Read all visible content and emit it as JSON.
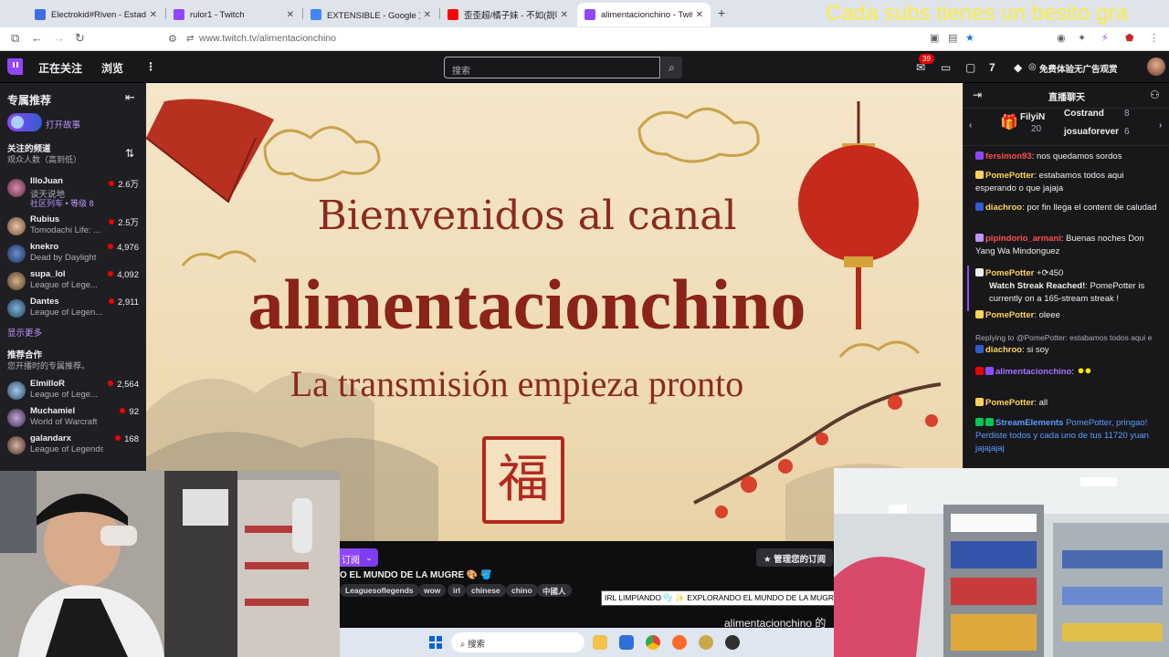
{
  "browser": {
    "tabs": [
      {
        "label": "Electrokid#Riven - Estadístic",
        "active": false
      },
      {
        "label": "rulor1 - Twitch",
        "active": false
      },
      {
        "label": "EXTENSIBLE - Google 文档",
        "active": false
      },
      {
        "label": "歪歪超/橘子妹 - 不如(說唱版)",
        "active": false
      },
      {
        "label": "alimentacionchino - Twitch",
        "active": true
      }
    ],
    "url": "www.twitch.tv/alimentacionchino",
    "overlay_text": "Cada subs tienes un besito gra"
  },
  "twitch_nav": {
    "following": "正在关注",
    "browse": "浏览",
    "more": "⋮",
    "search_placeholder": "搜索",
    "notifications_count": "39",
    "ad_free": "免费体验无广告观赏"
  },
  "sidebar": {
    "title": "专属推荐",
    "story_label": "打开故事",
    "followed_heading": "关注的频道",
    "followed_sort": "观众人数（高到低）",
    "followed": [
      {
        "name": "IlloJuan",
        "game": "谈天说地",
        "viewers": "2.6万",
        "extra": "社区列车 • 等级 8"
      },
      {
        "name": "Rubius",
        "game": "Tomodachi Life: ...",
        "viewers": "2.5万"
      },
      {
        "name": "knekro",
        "game": "Dead by Daylight",
        "viewers": "4,976"
      },
      {
        "name": "supa_lol",
        "game": "League of Lege...",
        "viewers": "4,092"
      },
      {
        "name": "Dantes",
        "game": "League of Legen...",
        "viewers": "2,911"
      }
    ],
    "show_more": "显示更多",
    "recommended_heading": "推荐合作",
    "recommended_sub": "您开播时的专属推荐。",
    "recommended": [
      {
        "name": "ElmilloR",
        "game": "League of Lege...",
        "viewers": "2,564"
      },
      {
        "name": "Muchamiel",
        "game": "World of Warcraft",
        "viewers": "92"
      },
      {
        "name": "galandarx",
        "game": "League of Legends",
        "viewers": "168"
      }
    ]
  },
  "stream": {
    "line1": "Bienvenidos al canal",
    "line2": "alimentacionchino",
    "line3": "La transmisión empieza pronto",
    "seal": "福"
  },
  "info": {
    "follow": "订阅",
    "manage_sub": "管理您的订阅",
    "title_partial": "O EL MUNDO DE LA MUGRE 🎨 🪣",
    "tags": [
      "Leaguesoflegends",
      "wow",
      "irl",
      "chinese",
      "chino",
      "中國人"
    ],
    "tooltip": "IRL LIMPIANDO 🫧 ✨ EXPLORANDO EL MUNDO DE LA MUGRE 🎨",
    "footer_partial": "alimentacionchino 的"
  },
  "chat": {
    "title": "直播聊天",
    "gifters": [
      {
        "name": "FilyiN",
        "count": "20"
      },
      {
        "name": "Costrand",
        "count": "8"
      },
      {
        "name": "josuaforever",
        "count": "6"
      }
    ],
    "messages": [
      {
        "user": "fersimon93",
        "color": "#ff4f4f",
        "text": ": nos quedamos sordos"
      },
      {
        "user": "PomePotter",
        "color": "#ffd257",
        "text": ": estabamos todos aqui esperando o que jajaja"
      },
      {
        "user": "diachroo",
        "color": "#ffd257",
        "text": ": por fin llega el content de caludad"
      },
      {
        "user": "pipindorio_armani",
        "color": "#ff4f4f",
        "text": ": Buenas noches Don Yang Wa Mindonguez"
      },
      {
        "user": "PomePotter",
        "color": "#ffd257",
        "text": " +⟳450"
      },
      {
        "user": "Watch Streak Reached!",
        "color": "#efeff1",
        "text": ": PomePotter is currently on a 165-stream streak !"
      },
      {
        "user": "PomePotter",
        "color": "#ffd257",
        "text": ": oleee"
      },
      {
        "user": "",
        "color": "#adadb8",
        "text": "Replying to @PomePotter: estabamos todos aqui e"
      },
      {
        "user": "diachroo",
        "color": "#ffd257",
        "text": ": si soy"
      },
      {
        "user": "alimentacionchino",
        "color": "#a970ff",
        "text": ":"
      },
      {
        "user": "PomePotter",
        "color": "#ffd257",
        "text": ": all"
      },
      {
        "user": "StreamElements",
        "color": "#5c9cff",
        "text": " PomePotter, pringao! Perdiste todos y cada uno de tus 11720 yuan jajajajaj"
      }
    ]
  },
  "taskbar": {
    "search": "搜索"
  },
  "colors": {
    "twitch_purple": "#9147ff",
    "stream_red": "#8b2318",
    "live_red": "#eb0400",
    "overlay_yellow": "#ffee33"
  }
}
